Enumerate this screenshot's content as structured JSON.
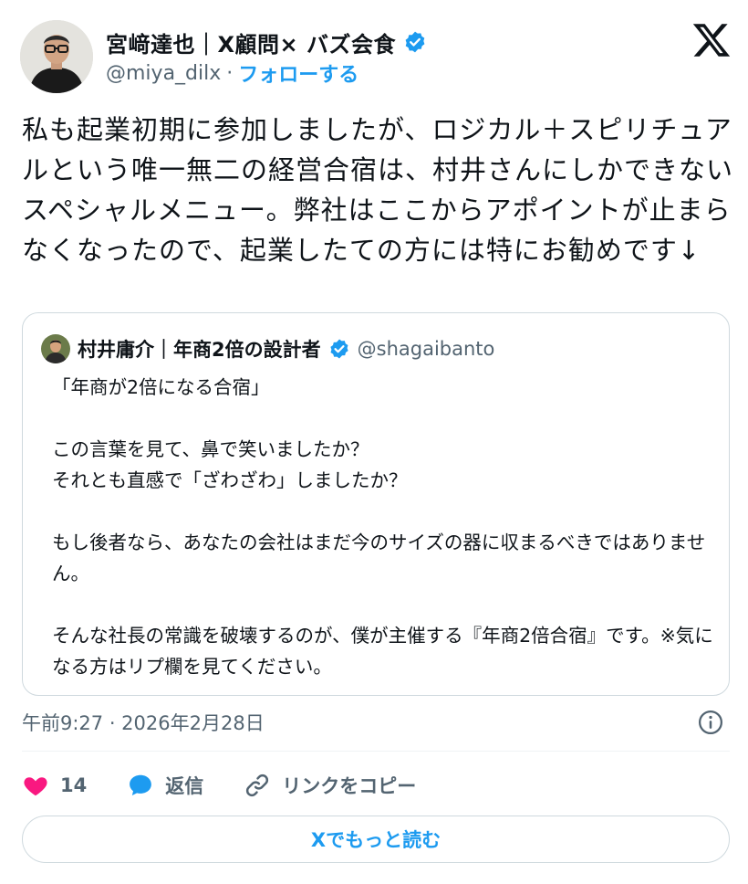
{
  "author": {
    "display_name": "宮﨑達也｜X顧問× バズ会食",
    "handle": "@miya_dilx",
    "separator": "·",
    "follow_label": "フォローする",
    "verified": true
  },
  "tweet": {
    "text": "私も起業初期に参加しましたが、ロジカル＋スピリチュアルという唯一無二の経営合宿は、村井さんにしかできないスペシャルメニュー。弊社はここからアポイントが止まらなくなったので、起業したての方には特にお勧めです↓"
  },
  "quote": {
    "display_name": "村井庸介｜年商2倍の設計者",
    "handle": "@shagaibanto",
    "verified": true,
    "text": "「年商が2倍になる合宿」\n\nこの言葉を見て、鼻で笑いましたか？\nそれとも直感で「ざわざわ」しましたか？\n\nもし後者なら、あなたの会社はまだ今のサイズの器に収まるべきではありません。\n\nそんな社長の常識を破壊するのが、僕が主催する『年商2倍合宿』です。※気になる方はリプ欄を見てください。"
  },
  "meta": {
    "timestamp": "午前9:27 · 2026年2月28日"
  },
  "actions": {
    "like_count": "14",
    "reply_label": "返信",
    "copy_link_label": "リンクをコピー"
  },
  "read_more_label": "Xでもっと読む",
  "colors": {
    "accent": "#1d9bf0",
    "like": "#f91880",
    "text": "#0f1419",
    "secondary": "#536471",
    "border": "#cfd9de"
  },
  "icons": {
    "logo": "x-logo-icon",
    "verified": "verified-badge-icon",
    "info": "info-icon",
    "like": "heart-icon",
    "reply": "speech-bubble-icon",
    "copy": "link-icon"
  }
}
